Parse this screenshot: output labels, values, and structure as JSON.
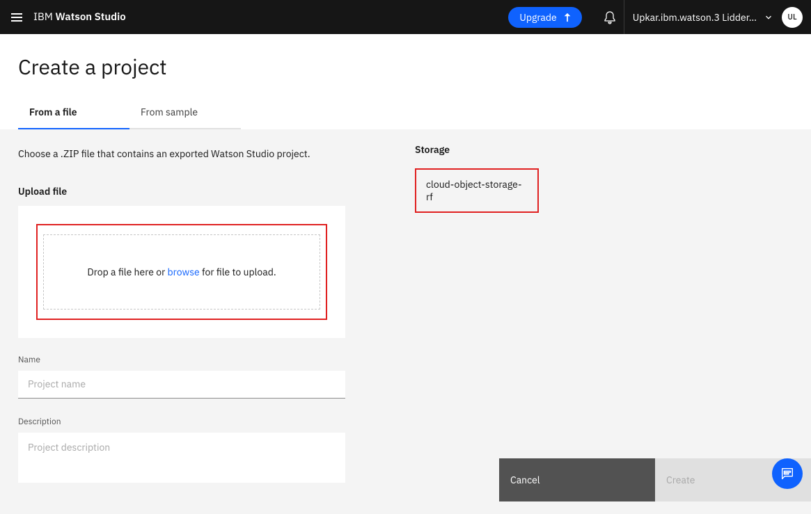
{
  "header": {
    "brand_ibm": "IBM",
    "brand_product": "Watson Studio",
    "upgrade_label": "Upgrade",
    "username": "Upkar.ibm.watson.3 Lidder…",
    "avatar_initials": "UL"
  },
  "page": {
    "title": "Create a project",
    "tabs": [
      {
        "label": "From a file",
        "active": true
      },
      {
        "label": "From sample",
        "active": false
      }
    ],
    "intro": "Choose a .ZIP file that contains an exported Watson Studio project.",
    "upload": {
      "section_label": "Upload file",
      "drop_prefix": "Drop a file here or ",
      "browse_label": "browse",
      "drop_suffix": " for file to upload."
    },
    "name_field": {
      "label": "Name",
      "placeholder": "Project name",
      "value": ""
    },
    "desc_field": {
      "label": "Description",
      "placeholder": "Project description",
      "value": ""
    },
    "storage": {
      "label": "Storage",
      "selected": "cloud-object-storage-rf"
    },
    "buttons": {
      "cancel": "Cancel",
      "create": "Create"
    }
  },
  "highlights": {
    "color": "#e02020"
  }
}
